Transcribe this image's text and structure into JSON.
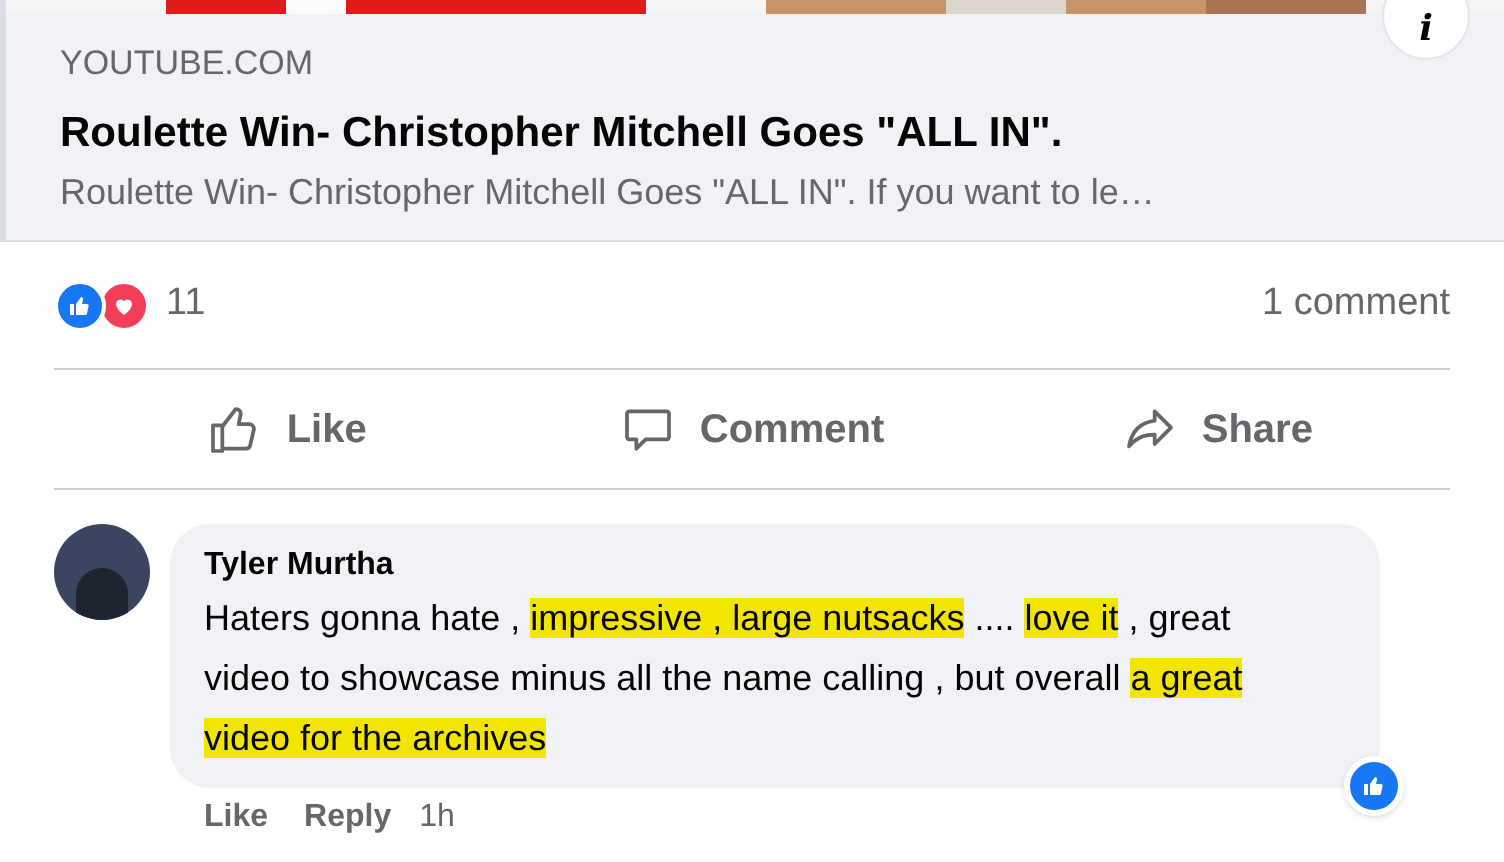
{
  "link_preview": {
    "kind": "picture",
    "domain": "YOUTUBE.COM",
    "title": "Roulette Win- Christopher Mitchell Goes \"ALL IN\".",
    "description": "Roulette Win- Christopher Mitchell Goes \"ALL IN\". If you want to le…",
    "info": "i"
  },
  "reactions": {
    "count": "11",
    "comments": "1 comment"
  },
  "actions": [
    {
      "kind": "like",
      "label": "Like"
    },
    {
      "kind": "comment",
      "label": "Comment"
    },
    {
      "kind": "share",
      "label": "Share"
    }
  ],
  "comment": {
    "author": "Tyler Murtha",
    "segments": [
      {
        "text": "Haters gonna hate , ",
        "highlighted": false
      },
      {
        "text": "impressive , large nutsacks",
        "highlighted": true
      },
      {
        "text": " .... ",
        "highlighted": false
      },
      {
        "text": "love it",
        "highlighted": true
      },
      {
        "text": " , great video to showcase minus all the name calling , but overall ",
        "highlighted": false
      },
      {
        "text": "a great video for the archives",
        "highlighted": true
      }
    ],
    "actions": [
      "Like",
      "Reply"
    ],
    "time": "1h"
  }
}
